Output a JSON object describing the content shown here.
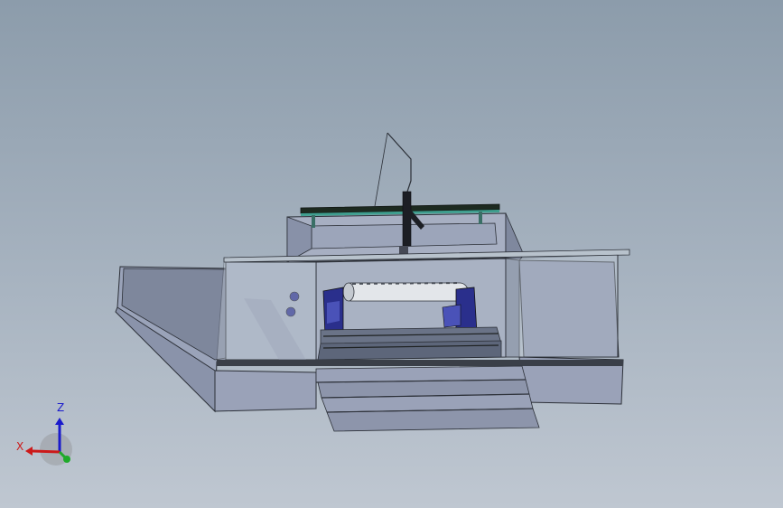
{
  "triad": {
    "z_label": "Z",
    "x_label": "X",
    "y_label": "",
    "z_color": "#1a1acc",
    "x_color": "#cc1a1a",
    "y_color": "#1faa2a"
  },
  "model": {
    "background_top": "#8c9cab",
    "background_bottom": "#bfc7d1",
    "body_color": "#8f98b0",
    "glass_color": "#c9d3dc",
    "fixture_color": "#2a2f8c",
    "rail_color": "#1d2a20",
    "rail_accent": "#3f9f8f"
  }
}
